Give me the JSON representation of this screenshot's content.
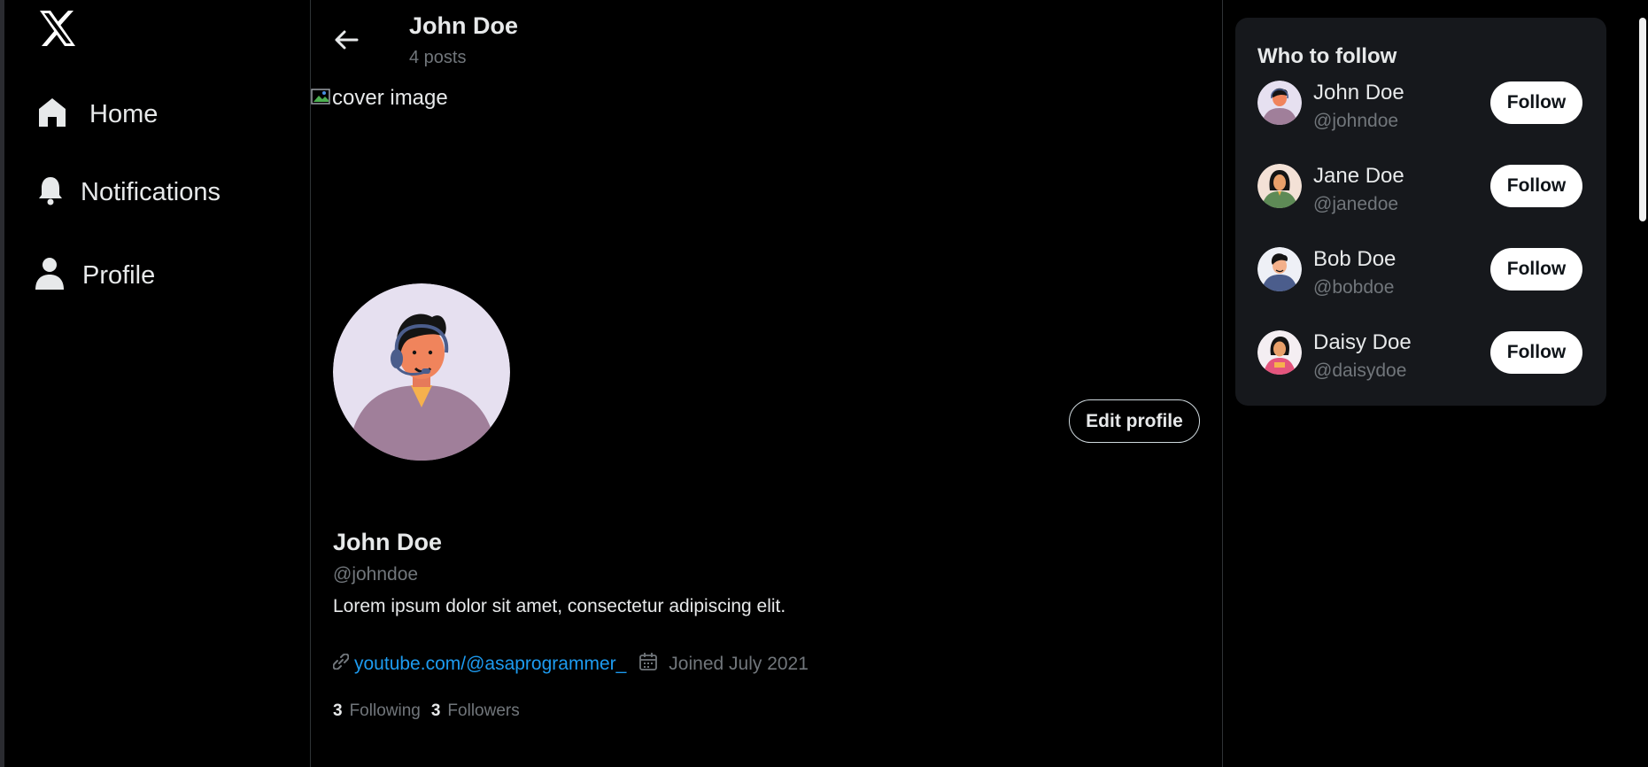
{
  "sidebar": {
    "logo": "x-logo-icon",
    "items": [
      {
        "label": "Home",
        "icon": "home-icon"
      },
      {
        "label": "Notifications",
        "icon": "bell-icon"
      },
      {
        "label": "Profile",
        "icon": "user-icon"
      }
    ]
  },
  "header": {
    "name": "John Doe",
    "posts": "4 posts"
  },
  "cover": {
    "alt": "cover image"
  },
  "profile": {
    "name": "John Doe",
    "handle": "@johndoe",
    "bio": "Lorem ipsum dolor sit amet, consectetur adipiscing elit.",
    "link": "youtube.com/@asaprogrammer_",
    "joined": "Joined July 2021",
    "edit_label": "Edit profile",
    "following_count": "3",
    "following_label": "Following",
    "followers_count": "3",
    "followers_label": "Followers"
  },
  "who_to_follow": {
    "title": "Who to follow",
    "follow_label": "Follow",
    "users": [
      {
        "name": "John Doe",
        "handle": "@johndoe",
        "avatar_color": "#a07f9a"
      },
      {
        "name": "Jane Doe",
        "handle": "@janedoe",
        "avatar_color": "#5e8a56"
      },
      {
        "name": "Bob Doe",
        "handle": "@bobdoe",
        "avatar_color": "#4b5d8c"
      },
      {
        "name": "Daisy Doe",
        "handle": "@daisydoe",
        "avatar_color": "#e4557d"
      }
    ]
  },
  "colors": {
    "background": "#000000",
    "panel": "#16181c",
    "accent": "#1d9bf0",
    "muted": "#71767b",
    "text": "#e7e9ea"
  }
}
